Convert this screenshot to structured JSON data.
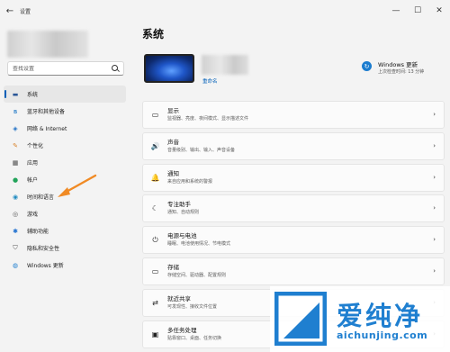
{
  "window": {
    "title": "设置",
    "back_icon": "arrow-left-icon",
    "minimize": "—",
    "maximize": "☐",
    "close": "✕"
  },
  "sidebar": {
    "search": {
      "placeholder": "查找设置"
    },
    "items": [
      {
        "label": "系统",
        "icon": "monitor-icon",
        "glyph": "▬",
        "color": "#2b5797",
        "active": true
      },
      {
        "label": "蓝牙和其他设备",
        "icon": "bluetooth-icon",
        "glyph": "ʙ",
        "color": "#0067c0",
        "active": false
      },
      {
        "label": "网络 & Internet",
        "icon": "wifi-icon",
        "glyph": "◈",
        "color": "#1e6fc5",
        "active": false
      },
      {
        "label": "个性化",
        "icon": "brush-icon",
        "glyph": "✎",
        "color": "#d8822a",
        "active": false
      },
      {
        "label": "应用",
        "icon": "apps-icon",
        "glyph": "▦",
        "color": "#4a4a4a",
        "active": false
      },
      {
        "label": "帐户",
        "icon": "account-icon",
        "glyph": "●",
        "color": "#22a35a",
        "active": false
      },
      {
        "label": "时间和语言",
        "icon": "globe-clock-icon",
        "glyph": "◉",
        "color": "#1f8ac0",
        "active": false
      },
      {
        "label": "游戏",
        "icon": "gamepad-icon",
        "glyph": "◎",
        "color": "#555555",
        "active": false
      },
      {
        "label": "辅助功能",
        "icon": "accessibility-icon",
        "glyph": "✱",
        "color": "#1c6ecf",
        "active": false
      },
      {
        "label": "隐私和安全性",
        "icon": "shield-icon",
        "glyph": "⛉",
        "color": "#555555",
        "active": false
      },
      {
        "label": "Windows 更新",
        "icon": "windows-update-icon",
        "glyph": "◍",
        "color": "#1b7ccf",
        "active": false
      }
    ]
  },
  "main": {
    "title": "系统",
    "device": {
      "rename": "重命名"
    },
    "update": {
      "title": "Windows 更新",
      "subtitle": "上次检查时间: 13 分钟"
    },
    "cards": [
      {
        "title": "显示",
        "desc": "监视器、亮度、夜间模式、显示描述文件",
        "icon": "display-icon",
        "glyph": "▭"
      },
      {
        "title": "声音",
        "desc": "音量级别、输出、输入、声音设备",
        "icon": "speaker-icon",
        "glyph": "🔊"
      },
      {
        "title": "通知",
        "desc": "来自应用和系统的警报",
        "icon": "bell-icon",
        "glyph": "🔔"
      },
      {
        "title": "专注助手",
        "desc": "通知、自动规则",
        "icon": "moon-icon",
        "glyph": "☾"
      },
      {
        "title": "电源与电池",
        "desc": "睡眠、电池使用情况、节电模式",
        "icon": "power-icon",
        "glyph": "⏻"
      },
      {
        "title": "存储",
        "desc": "存储空间、驱动器、配置规则",
        "icon": "storage-icon",
        "glyph": "▭"
      },
      {
        "title": "就近共享",
        "desc": "可发现性、接收文件位置",
        "icon": "share-icon",
        "glyph": "⇄"
      },
      {
        "title": "多任务处理",
        "desc": "贴靠窗口、桌面、任务切换",
        "icon": "multitask-icon",
        "glyph": "▣"
      }
    ]
  },
  "watermark": {
    "brand": "爱纯净",
    "url": "aichunjing.com"
  }
}
